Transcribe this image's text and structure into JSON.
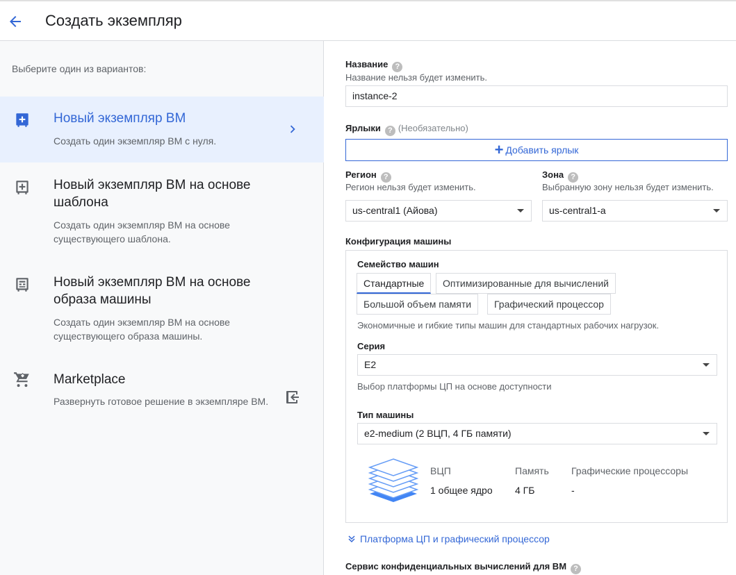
{
  "header": {
    "title": "Создать экземпляр"
  },
  "left": {
    "intro": "Выберите один из вариантов:",
    "options": [
      {
        "title": "Новый экземпляр ВМ",
        "desc": "Создать один экземпляр ВМ с нуля."
      },
      {
        "title": "Новый экземпляр ВМ на основе шаблона",
        "desc": "Создать один экземпляр ВМ на основе существующего шаблона."
      },
      {
        "title": "Новый экземпляр ВМ на основе образа машины",
        "desc": "Создать один экземпляр ВМ на основе существующего образа машины."
      },
      {
        "title": "Marketplace",
        "desc": "Развернуть готовое решение в экземпляре ВМ."
      }
    ]
  },
  "form": {
    "name_label": "Название",
    "name_hint": "Название нельзя будет изменить.",
    "name_value": "instance-2",
    "labels_label": "Ярлыки",
    "labels_optional": "(Необязательно)",
    "add_label_button": "Добавить ярлык",
    "region_label": "Регион",
    "region_hint": "Регион нельзя будет изменить.",
    "region_value": "us-central1 (Айова)",
    "zone_label": "Зона",
    "zone_hint": "Выбранную зону нельзя будет изменить.",
    "zone_value": "us-central1-a",
    "machine_config_label": "Конфигурация машины",
    "family_label": "Семейство машин",
    "family_tabs": [
      "Стандартные",
      "Оптимизированные для вычислений",
      "Большой объем памяти",
      "Графический процессор"
    ],
    "family_desc": "Экономичные и гибкие типы машин для стандартных рабочих нагрузок.",
    "series_label": "Серия",
    "series_value": "E2",
    "series_hint": "Выбор платформы ЦП на основе доступности",
    "machine_type_label": "Тип машины",
    "machine_type_value": "e2-medium (2 ВЦП, 4 ГБ памяти)",
    "specs": {
      "vcpu_header": "ВЦП",
      "memory_header": "Память",
      "gpu_header": "Графические процессоры",
      "vcpu_value": "1 общее ядро",
      "memory_value": "4 ГБ",
      "gpu_value": "-"
    },
    "cpu_platform_link": "Платформа ЦП и графический процессор",
    "confidential_label": "Сервис конфиденциальных вычислений для ВМ",
    "help_glyph": "?"
  },
  "colors": {
    "accent": "#3367d6",
    "selected_bg": "#e8f0fe",
    "panel_bg": "#f8f9fa"
  }
}
